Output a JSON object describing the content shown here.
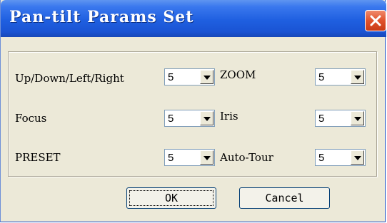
{
  "window": {
    "title": "Pan-tilt Params Set"
  },
  "icons": {
    "close": "close-icon",
    "dropdown": "chevron-down-icon"
  },
  "fields": [
    {
      "id": "updown",
      "label": "Up/Down/Left/Right",
      "value": "5"
    },
    {
      "id": "zoom",
      "label": "ZOOM",
      "value": "5"
    },
    {
      "id": "focus",
      "label": "Focus",
      "value": "5"
    },
    {
      "id": "iris",
      "label": "Iris",
      "value": "5"
    },
    {
      "id": "preset",
      "label": "PRESET",
      "value": "5"
    },
    {
      "id": "autotour",
      "label": "Auto-Tour",
      "value": "5"
    }
  ],
  "buttons": {
    "ok": "OK",
    "cancel": "Cancel"
  },
  "colors": {
    "titlebar": "#1f5fe0",
    "close": "#e0522c",
    "dialog_bg": "#ece9d8"
  }
}
